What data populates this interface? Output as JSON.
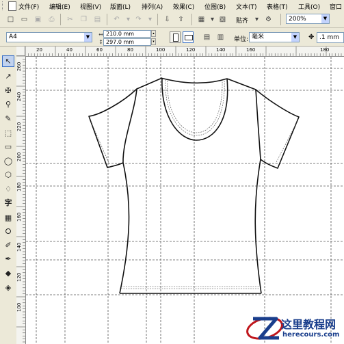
{
  "menu": [
    {
      "label": "文件(F)"
    },
    {
      "label": "编辑(E)"
    },
    {
      "label": "视图(V)"
    },
    {
      "label": "版面(L)"
    },
    {
      "label": "排列(A)"
    },
    {
      "label": "效果(C)"
    },
    {
      "label": "位图(B)"
    },
    {
      "label": "文本(T)"
    },
    {
      "label": "表格(T)"
    },
    {
      "label": "工具(O)"
    },
    {
      "label": "窗口"
    }
  ],
  "toolbar": {
    "snap_label": "贴齐",
    "zoom_value": "200%"
  },
  "property_bar": {
    "paper_size": "A4",
    "width": "210.0 mm",
    "height": "297.0 mm",
    "unit_label": "单位:",
    "unit_value": "毫米",
    "nudge_value": ".1 mm"
  },
  "ruler": {
    "horizontal_labels": [
      "20",
      "40",
      "60",
      "80",
      "100",
      "120",
      "140",
      "160",
      "180"
    ],
    "vertical_labels": [
      "260",
      "240",
      "220",
      "200",
      "180",
      "160",
      "140",
      "120",
      "100"
    ]
  },
  "watermark": {
    "title": "这里教程网",
    "url": "herecours.com"
  },
  "colors": {
    "ui_background": "#ece9d8",
    "selection": "#316ac5",
    "watermark": "#1a3e8c",
    "watermark_accent": "#c0161c"
  }
}
